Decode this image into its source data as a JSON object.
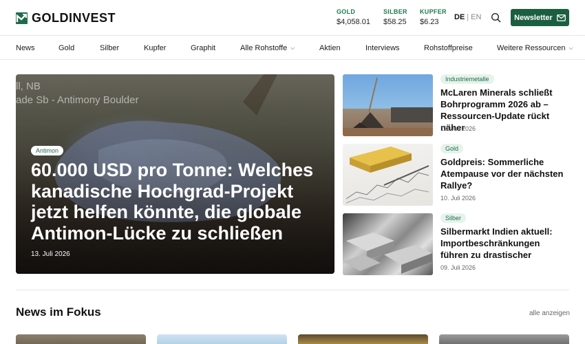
{
  "brand": {
    "name": "GOLDINVEST",
    "accent": "#1f6b4a"
  },
  "prices": [
    {
      "label": "GOLD",
      "value": "$4,058.01"
    },
    {
      "label": "SILBER",
      "value": "$58.25"
    },
    {
      "label": "KUPFER",
      "value": "$6.23"
    }
  ],
  "lang": {
    "active": "DE",
    "separator": "|",
    "other": "EN"
  },
  "search": {
    "icon": "search-icon"
  },
  "newsletter": {
    "label": "Newsletter",
    "icon": "mail-icon"
  },
  "nav": {
    "items": [
      {
        "label": "News"
      },
      {
        "label": "Gold"
      },
      {
        "label": "Silber"
      },
      {
        "label": "Kupfer"
      },
      {
        "label": "Graphit"
      },
      {
        "label": "Alle Rohstoffe",
        "dropdown": true
      },
      {
        "label": "Aktien"
      },
      {
        "label": "Interviews"
      },
      {
        "label": "Rohstoffpreise"
      },
      {
        "label": "Weitere Ressourcen",
        "dropdown": true
      }
    ]
  },
  "hero": {
    "image_text": "ll, NB\nade Sb - Antimony Boulder",
    "tag": "Antimon",
    "title": "60.000 USD pro Tonne: Welches kanadische Hochgrad-Projekt jetzt helfen könnte, die globale Antimon-Lücke zu schließen",
    "date": "13. Juli 2026"
  },
  "side_articles": [
    {
      "tag": "Industriemetalle",
      "title": "McLaren Minerals schließt Bohrprogramm 2026 ab – Ressourcen-Update rückt näher",
      "date": "13. Juli 2026"
    },
    {
      "tag": "Gold",
      "title": "Goldpreis: Sommerliche Atempause vor der nächsten Rallye?",
      "date": "10. Juli 2026"
    },
    {
      "tag": "Silber",
      "title": "Silbermarkt Indien aktuell: Importbeschränkungen führen zu drastischer physischer…",
      "date": "09. Juli 2026"
    }
  ],
  "focus": {
    "title": "News im Fokus",
    "see_all": "alle anzeigen"
  }
}
